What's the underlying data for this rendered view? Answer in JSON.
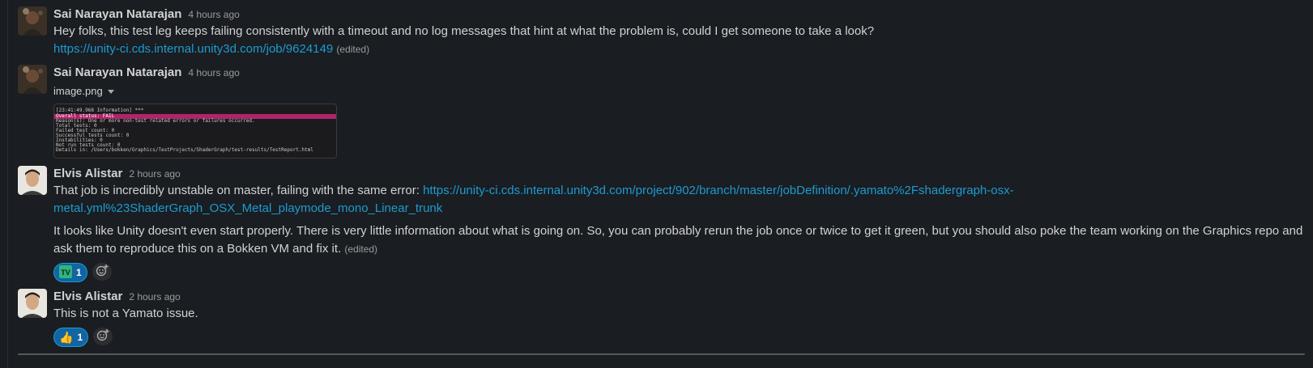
{
  "messages": [
    {
      "author": "Sai Narayan Natarajan",
      "time": "4 hours ago",
      "text": "Hey folks, this test leg keeps failing consistently with a timeout and no log messages that hint at what the problem is, could I get someone to take a look?",
      "link": "https://unity-ci.cds.internal.unity3d.com/job/9624149",
      "edited": "(edited)"
    },
    {
      "author": "Sai Narayan Natarajan",
      "time": "4 hours ago",
      "file_name": "image.png",
      "image_lines": [
        "[23:41:49.968 Information] ***",
        "Overall status: FAIL",
        "Reason(s): One or more non-test related errors or failures occurred.",
        "Total tests: 0",
        "Failed test count: 0",
        "Successful tests count: 0",
        "Instabilities: 0",
        "Not run tests count: 0",
        "Details in: /Users/bokken/Graphics/TestProjects/ShaderGraph/test-results/TestReport.html"
      ]
    },
    {
      "author": "Elvis Alistar",
      "time": "2 hours ago",
      "text": "That job is incredibly unstable on master, failing with the same error:",
      "link_line1": "https://unity-ci.cds.internal.unity3d.com/project/902/branch/master/jobDefinition/.yamato%2Fshadergraph-osx-",
      "link_line2": "metal.yml%23ShaderGraph_OSX_Metal_playmode_mono_Linear_trunk",
      "para2_line1": "It looks like Unity doesn't even start properly. There is very little information about what is going on. So, you can probably rerun the job once or twice to get it green, but you should also poke the team working on the Graphics repo and",
      "para2_line2": "ask them to reproduce this on a Bokken VM and fix it.",
      "edited": "(edited)",
      "reaction": {
        "icon": "tv-emoji-icon",
        "count": "1"
      }
    },
    {
      "author": "Elvis Alistar",
      "time": "2 hours ago",
      "text": "This is not a Yamato issue.",
      "reaction": {
        "icon": "thumbs-up-icon",
        "emoji": "👍",
        "count": "1"
      }
    }
  ],
  "colors": {
    "link": "#1d9bd1",
    "reaction_bg": "#1264a3",
    "highlight": "#b0246a"
  }
}
